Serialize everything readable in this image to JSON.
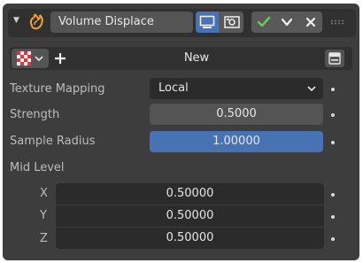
{
  "header": {
    "modifier_name": "Volume Displace",
    "icons": [
      "collapse-triangle-icon",
      "volume-displace-modifier-icon",
      "display-in-viewport-icon",
      "display-in-render-icon",
      "enable-icon",
      "dropdown-menu-icon",
      "delete-icon",
      "drag-handle-icon"
    ]
  },
  "texture": {
    "new_label": "New",
    "icons": [
      "texture-checker-icon",
      "plus-icon",
      "texture-properties-icon"
    ]
  },
  "fields": {
    "texture_mapping": {
      "label": "Texture Mapping",
      "value": "Local"
    },
    "strength": {
      "label": "Strength",
      "value": "0.5000"
    },
    "sample_radius": {
      "label": "Sample Radius",
      "value": "1.00000"
    },
    "mid_level": {
      "label": "Mid Level",
      "x": {
        "label": "X",
        "value": "0.50000"
      },
      "y": {
        "label": "Y",
        "value": "0.50000"
      },
      "z": {
        "label": "Z",
        "value": "0.50000"
      }
    }
  },
  "colors": {
    "panel_bg": "#3d3d3d",
    "header_bg": "#303030",
    "field_bg": "#545454",
    "active_blue": "#4772b3",
    "accent_orange": "#e8a53a",
    "check_green": "#6bd84e"
  }
}
